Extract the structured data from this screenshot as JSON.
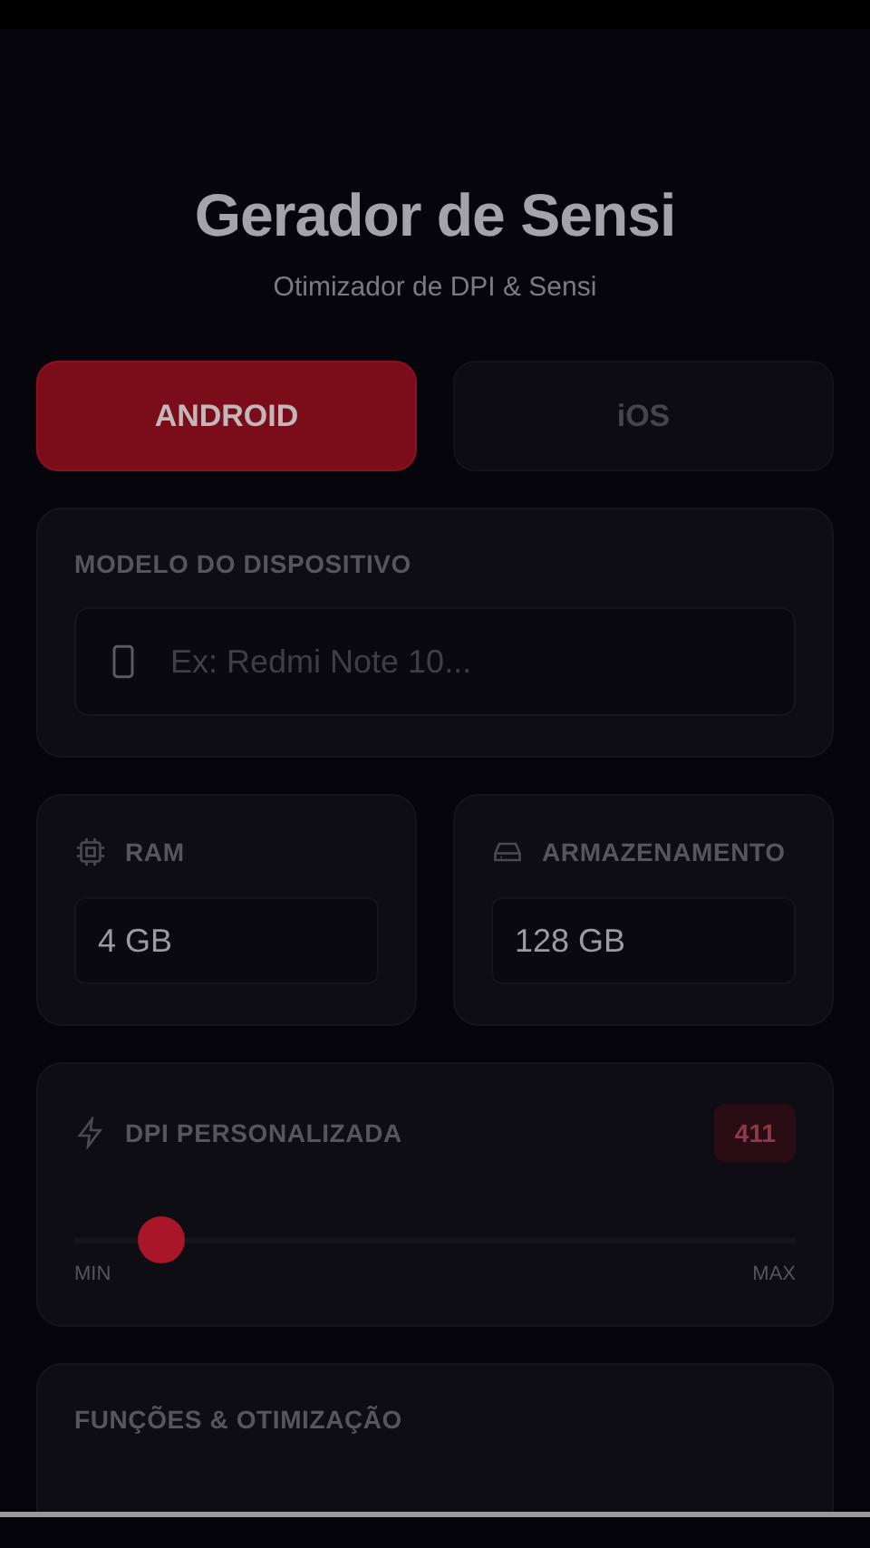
{
  "header": {
    "title": "Gerador de Sensi",
    "subtitle": "Otimizador de DPI & Sensi"
  },
  "platforms": [
    {
      "label": "ANDROID",
      "selected": true
    },
    {
      "label": "iOS",
      "selected": false
    }
  ],
  "device_model": {
    "label": "MODELO DO DISPOSITIVO",
    "placeholder": "Ex: Redmi Note 10..."
  },
  "specs": [
    {
      "kind": "ram",
      "label": "RAM",
      "value": "4 GB"
    },
    {
      "kind": "storage",
      "label": "ARMAZENAMENTO",
      "value": "128 GB"
    }
  ],
  "dpi": {
    "label": "DPI PERSONALIZADA",
    "reading": "411",
    "level": 0.12,
    "min_label": "MIN",
    "max_label": "MAX"
  },
  "functions": {
    "label": "FUNÇÕES & OTIMIZAÇÃO"
  }
}
